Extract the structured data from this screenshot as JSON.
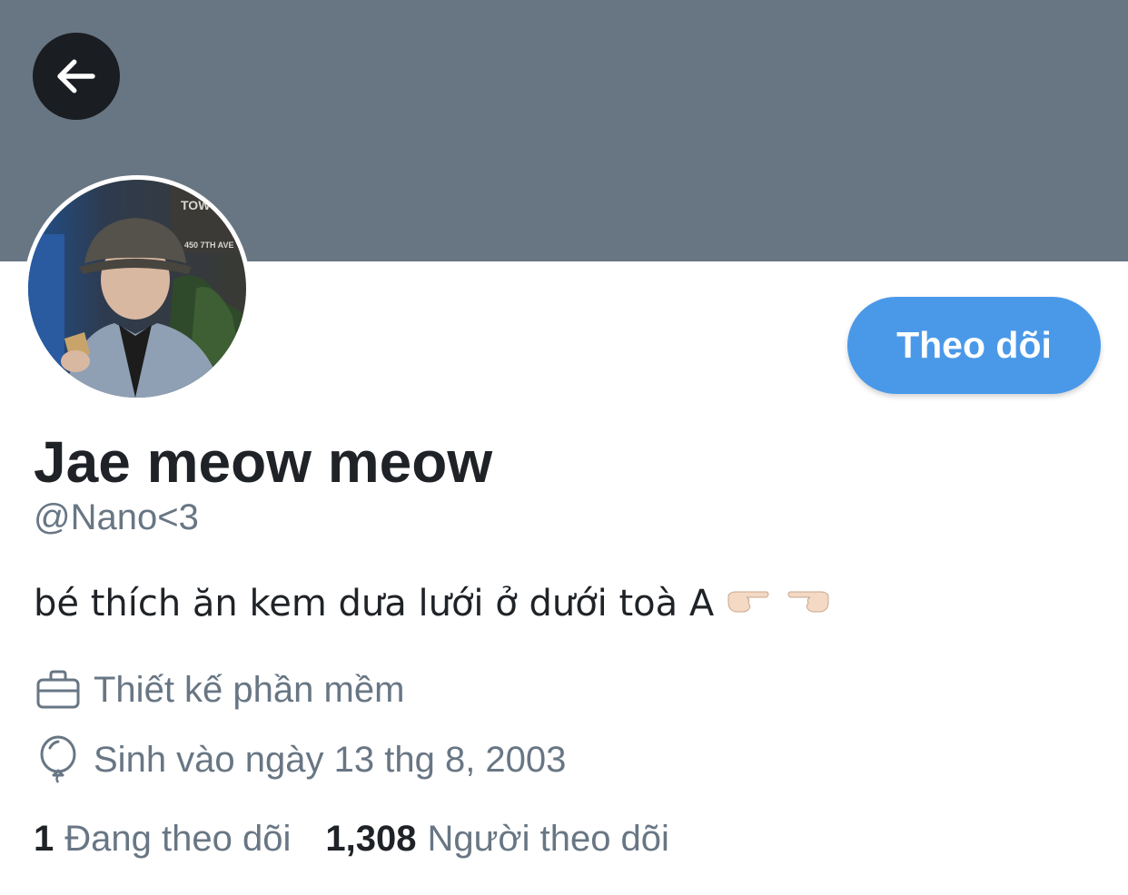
{
  "profile": {
    "display_name": "Jae meow meow",
    "handle": "@Nano<3",
    "bio": "bé thích ăn kem dưa lưới ở dưới toà A",
    "occupation": "Thiết kế phần mềm",
    "birthday": "Sinh vào ngày 13 thg 8, 2003",
    "avatar_sign_text": "TOW",
    "avatar_address_text": "450 7TH AVE"
  },
  "actions": {
    "follow_label": "Theo dõi"
  },
  "stats": {
    "following_count": "1",
    "following_label": "Đang theo dõi",
    "followers_count": "1,308",
    "followers_label": "Người theo dõi"
  },
  "icons": {
    "back": "arrow-left-icon",
    "occupation": "briefcase-icon",
    "birthday": "balloon-icon",
    "bio_emoji": [
      "pointing-right-hand-icon",
      "pointing-left-hand-icon"
    ]
  },
  "colors": {
    "banner": "#687684",
    "accent": "#4a99e9",
    "secondary_text": "#687684",
    "primary_text": "#1f2327"
  }
}
